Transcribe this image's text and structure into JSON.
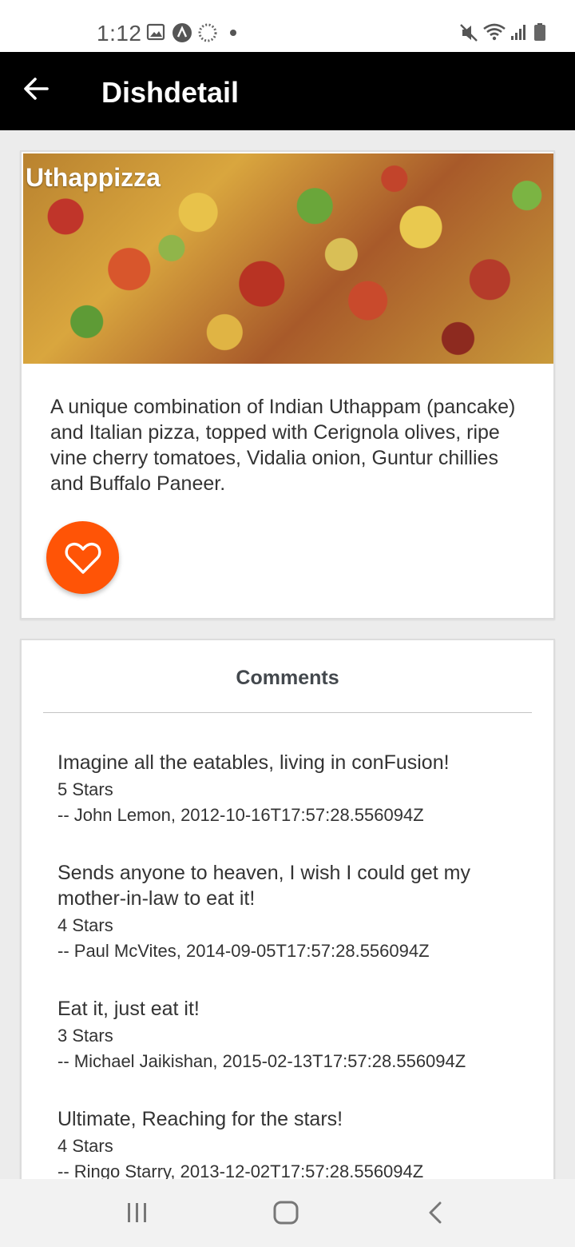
{
  "status_bar": {
    "time": "1:12",
    "left_icons": [
      "gallery-icon",
      "app-icon",
      "loading-icon"
    ],
    "right_icons": [
      "mute-icon",
      "wifi-icon",
      "signal-icon",
      "battery-icon"
    ]
  },
  "app_bar": {
    "title": "Dishdetail",
    "back_icon": "arrow-left-icon"
  },
  "dish": {
    "name": "Uthappizza",
    "description": " A unique combination of Indian Uthappam (pancake) and Italian pizza, topped with Cerignola olives, ripe vine cherry tomatoes, Vidalia onion, Guntur chillies and Buffalo Paneer.",
    "favorite_icon": "heart-outline-icon",
    "accent_color": "#ff5406"
  },
  "comments": {
    "title": "Comments",
    "items": [
      {
        "text": "Imagine all the eatables, living in conFusion!",
        "rating": "5 Stars",
        "author": "-- John Lemon, 2012-10-16T17:57:28.556094Z"
      },
      {
        "text": "Sends anyone to heaven, I wish I could get my mother-in-law to eat it!",
        "rating": "4 Stars",
        "author": "-- Paul McVites, 2014-09-05T17:57:28.556094Z"
      },
      {
        "text": "Eat it, just eat it!",
        "rating": "3 Stars",
        "author": "-- Michael Jaikishan, 2015-02-13T17:57:28.556094Z"
      },
      {
        "text": "Ultimate, Reaching for the stars!",
        "rating": "4 Stars",
        "author": "-- Ringo Starry, 2013-12-02T17:57:28.556094Z"
      }
    ]
  },
  "nav_bar": {
    "icons": [
      "recent-apps-icon",
      "home-icon",
      "back-icon"
    ]
  }
}
